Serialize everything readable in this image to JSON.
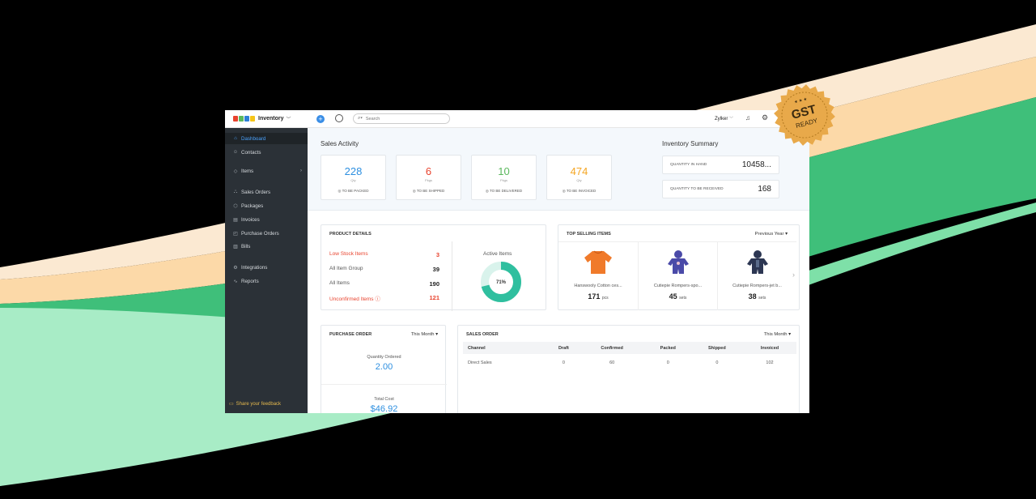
{
  "colors": {
    "accent": "#4aa3ff",
    "red": "#e8432e",
    "orange": "#f5a623",
    "green": "#5bb85d",
    "teal": "#2fbf9f",
    "sidebar": "#2b3137"
  },
  "brand": {
    "name": "Inventory",
    "logo_letters": [
      "Z",
      "O",
      "H",
      "O"
    ],
    "logo_colors": [
      "#e8432e",
      "#5bb85d",
      "#2d7fd6",
      "#f5c518"
    ]
  },
  "badge": {
    "line1": "GST",
    "line2": "READY"
  },
  "topbar": {
    "search_placeholder": "Search",
    "org_name": "Zylker"
  },
  "sidebar": {
    "items": [
      {
        "label": "Dashboard",
        "icon": "home-icon",
        "glyph": "⌂"
      },
      {
        "label": "Contacts",
        "icon": "person-icon",
        "glyph": "☺"
      },
      {
        "label": "Items",
        "icon": "tag-icon",
        "glyph": "◇"
      },
      {
        "label": "Sales Orders",
        "icon": "cart-icon",
        "glyph": "⛬"
      },
      {
        "label": "Packages",
        "icon": "box-icon",
        "glyph": "⬡"
      },
      {
        "label": "Invoices",
        "icon": "doc-icon",
        "glyph": "▤"
      },
      {
        "label": "Purchase Orders",
        "icon": "bag-icon",
        "glyph": "◰"
      },
      {
        "label": "Bills",
        "icon": "bill-icon",
        "glyph": "▥"
      },
      {
        "label": "Integrations",
        "icon": "plug-icon",
        "glyph": "⚙"
      },
      {
        "label": "Reports",
        "icon": "chart-icon",
        "glyph": "∿"
      }
    ],
    "feedback": "Share your feedback"
  },
  "sales_activity": {
    "title": "Sales Activity",
    "cards": [
      {
        "value": "228",
        "unit": "Qty",
        "label": "TO BE PACKED",
        "color": "#2d8fe0"
      },
      {
        "value": "6",
        "unit": "Pkgs",
        "label": "TO BE SHIPPED",
        "color": "#e8432e"
      },
      {
        "value": "10",
        "unit": "Pkgs",
        "label": "TO BE DELIVERED",
        "color": "#5bb85d"
      },
      {
        "value": "474",
        "unit": "Qty",
        "label": "TO BE INVOICED",
        "color": "#f5a623"
      }
    ]
  },
  "inventory_summary": {
    "title": "Inventory Summary",
    "rows": [
      {
        "label": "QUANTITY IN HAND",
        "value": "10458..."
      },
      {
        "label": "QUANTITY TO BE RECEIVED",
        "value": "168"
      }
    ]
  },
  "product_details": {
    "title": "PRODUCT DETAILS",
    "rows": [
      {
        "label": "Low Stock Items",
        "value": "3"
      },
      {
        "label": "All Item Group",
        "value": "39"
      },
      {
        "label": "All Items",
        "value": "190"
      },
      {
        "label": "Unconfirmed Items",
        "value": "121"
      }
    ],
    "active_items_title": "Active Items",
    "active_pct": 71,
    "active_label": "71%"
  },
  "top_selling": {
    "title": "TOP SELLING ITEMS",
    "period": "Previous Year",
    "items": [
      {
        "name": "Hanswooly Cotton ces...",
        "qty": "171",
        "unit": "pcs",
        "color": "#f07a2a"
      },
      {
        "name": "Cutiepie Rompers-spo...",
        "qty": "45",
        "unit": "sets",
        "color": "#4a4aa8"
      },
      {
        "name": "Cutiepie Rompers-jet b...",
        "qty": "38",
        "unit": "sets",
        "color": "#2c3652"
      }
    ]
  },
  "purchase_order": {
    "title": "PURCHASE ORDER",
    "period": "This Month",
    "qty_label": "Quantity Ordered",
    "qty_value": "2.00",
    "cost_label": "Total Cost",
    "cost_value": "$46.92"
  },
  "sales_order": {
    "title": "SALES ORDER",
    "period": "This Month",
    "columns": [
      "Channel",
      "Draft",
      "Confirmed",
      "Packed",
      "Shipped",
      "Invoiced"
    ],
    "rows": [
      [
        "Direct Sales",
        "0",
        "60",
        "0",
        "0",
        "102"
      ]
    ]
  }
}
